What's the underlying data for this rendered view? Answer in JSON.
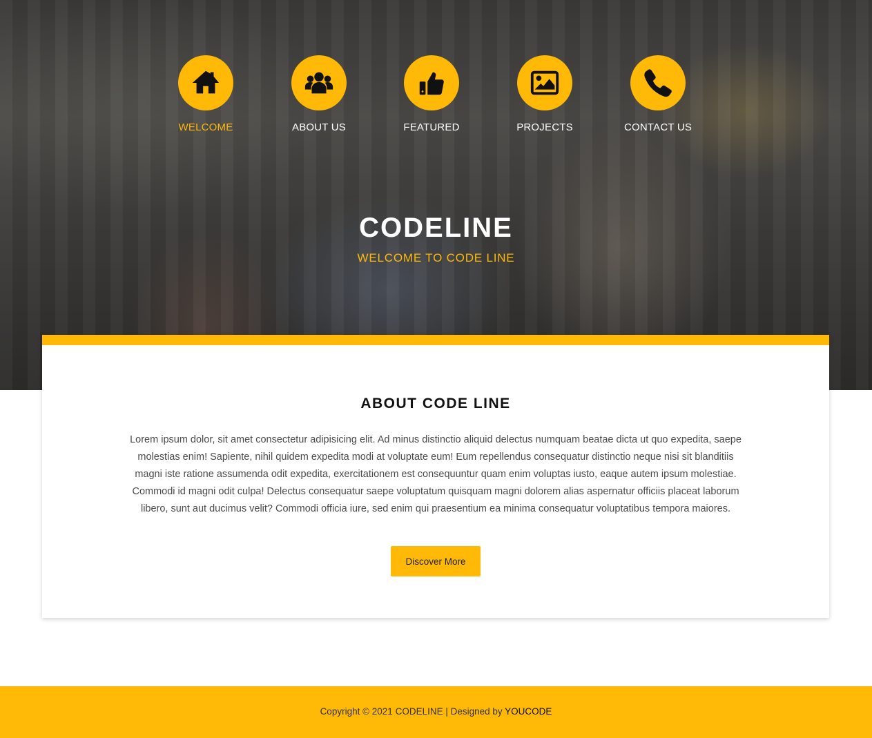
{
  "nav": {
    "items": [
      {
        "label": "WELCOME",
        "icon": "home-icon",
        "active": true
      },
      {
        "label": "ABOUT US",
        "icon": "users-icon",
        "active": false
      },
      {
        "label": "FEATURED",
        "icon": "thumbs-up-icon",
        "active": false
      },
      {
        "label": "PROJECTS",
        "icon": "image-icon",
        "active": false
      },
      {
        "label": "CONTACT US",
        "icon": "phone-icon",
        "active": false
      }
    ]
  },
  "hero": {
    "title": "CODELINE",
    "subtitle": "WELCOME TO CODE LINE"
  },
  "about": {
    "title": "ABOUT CODE LINE",
    "text": "Lorem ipsum dolor, sit amet consectetur adipisicing elit. Ad minus distinctio aliquid delectus numquam beatae dicta ut quo expedita, saepe molestias enim! Sapiente, nihil quidem expedita modi at voluptate eum! Eum repellendus consequatur distinctio neque nisi sit blanditiis magni iste ratione assumenda odit expedita, exercitationem est consequuntur quam enim voluptas iusto, eaque autem ipsum molestiae. Commodi id magni odit culpa! Delectus consequatur saepe voluptatum quisquam magni dolorem alias aspernatur officiis placeat laborum libero, sunt aut ducimus velit? Commodi officia iure, sed enim qui praesentium ea minima consequatur voluptatibus tempora maiores.",
    "button_label": "Discover More"
  },
  "footer": {
    "copyright": "Copyright © 2021 CODELINE | Designed by ",
    "designer": "YOUCODE"
  },
  "colors": {
    "accent": "#ffb906",
    "dark": "#111111",
    "text": "#4a4a4a"
  }
}
